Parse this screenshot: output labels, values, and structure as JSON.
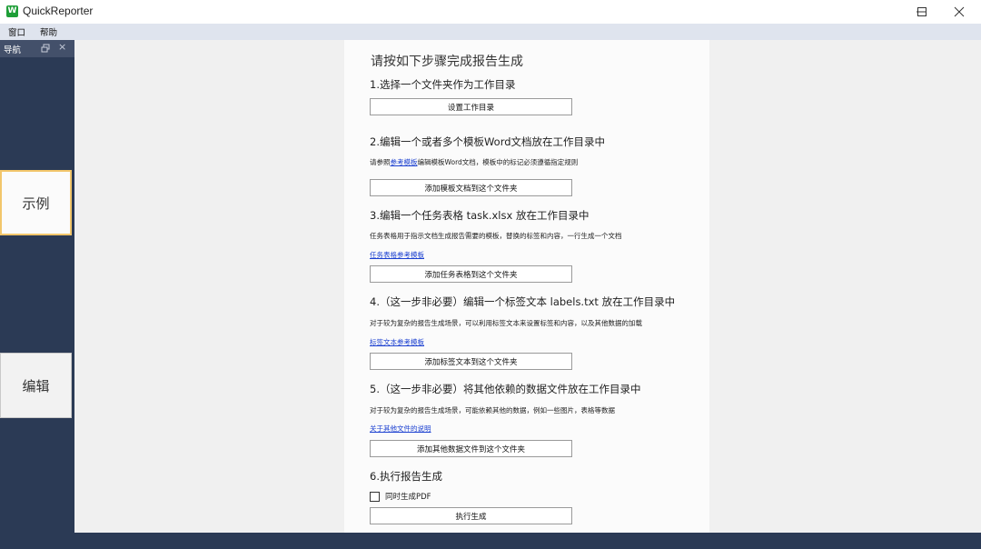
{
  "app": {
    "logo_letter": "W",
    "title": "QuickReporter"
  },
  "menu": [
    {
      "label": "窗口"
    },
    {
      "label": "帮助"
    }
  ],
  "nav": {
    "title": "导航",
    "close": "×",
    "buttons": [
      {
        "label": "示例"
      },
      {
        "label": "编辑"
      }
    ]
  },
  "content": {
    "heading": "请按如下步骤完成报告生成",
    "step1": {
      "title": "1.选择一个文件夹作为工作目录",
      "button": "设置工作目录"
    },
    "step2": {
      "title": "2.编辑一个或者多个模板Word文档放在工作目录中",
      "desc_prefix": "请参照",
      "desc_link": "参考模板",
      "desc_suffix": "编辑模板Word文档，模板中的标记必须遵循指定规则",
      "button": "添加模板文档到这个文件夹"
    },
    "step3": {
      "title": "3.编辑一个任务表格 task.xlsx 放在工作目录中",
      "desc": "任务表格用于指示文档生成报告需要的模板，替换的标签和内容，一行生成一个文档",
      "link": "任务表格参考模板",
      "button": "添加任务表格到这个文件夹"
    },
    "step4": {
      "title": "4.（这一步非必要）编辑一个标签文本 labels.txt 放在工作目录中",
      "desc": "对于较为复杂的报告生成场景，可以利用标签文本来设置标签和内容，以及其他数据的加载",
      "link": "标签文本参考模板",
      "button": "添加标签文本到这个文件夹"
    },
    "step5": {
      "title": "5.（这一步非必要）将其他依赖的数据文件放在工作目录中",
      "desc": "对于较为复杂的报告生成场景，可能依赖其他的数据，例如一些图片，表格等数据",
      "link": "关于其他文件的说明",
      "button": "添加其他数据文件到这个文件夹"
    },
    "step6": {
      "title": "6.执行报告生成",
      "checkbox_label": "同时生成PDF",
      "checkbox_checked": false,
      "button": "执行生成"
    }
  },
  "colors": {
    "nav_bg": "#2b3a55",
    "menubar_bg": "#dfe4ee",
    "link": "#1a3fd0",
    "selected_border": "#f2c66b"
  }
}
